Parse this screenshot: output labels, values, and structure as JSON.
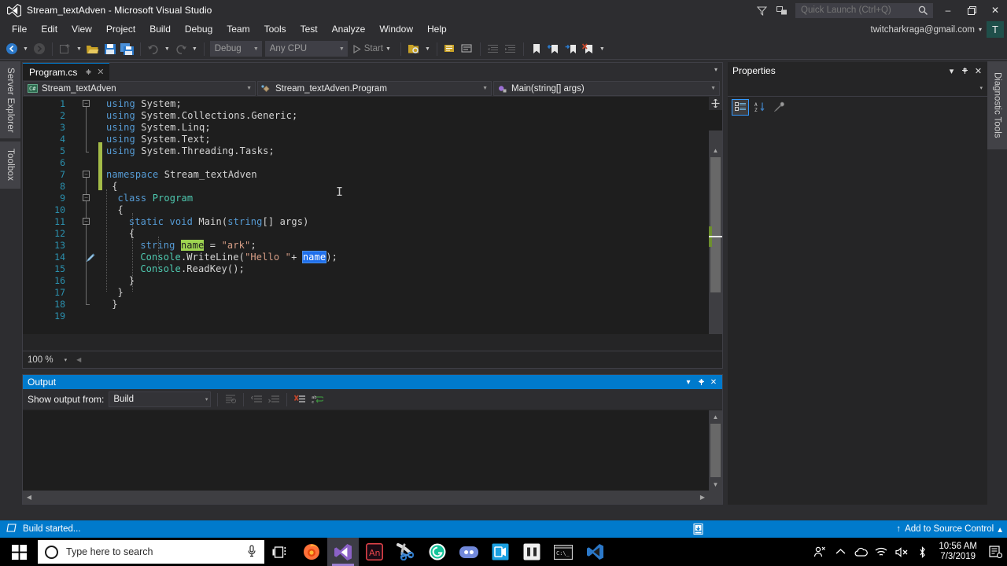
{
  "titlebar": {
    "title": "Stream_textAdven - Microsoft Visual Studio",
    "logo_icon": "visual-studio-logo",
    "feedback_icon": "feedback-funnel-icon",
    "notify_icon": "notifications-icon",
    "search_icon": "search-icon",
    "minimize": "–",
    "maximize": "❐",
    "close": "✕"
  },
  "quick_launch": {
    "placeholder": "Quick Launch (Ctrl+Q)",
    "value": ""
  },
  "menu": {
    "items": [
      "File",
      "Edit",
      "View",
      "Project",
      "Build",
      "Debug",
      "Team",
      "Tools",
      "Test",
      "Analyze",
      "Window",
      "Help"
    ]
  },
  "account": {
    "email": "twitcharkraga@gmail.com",
    "avatar_initial": "T",
    "caret": "▾"
  },
  "toolbar": {
    "back_icon": "navigate-backward-icon",
    "forward_icon": "navigate-forward-icon",
    "new_project_icon": "new-project-icon",
    "open_file_icon": "open-file-icon",
    "save_icon": "save-icon",
    "save_all_icon": "save-all-icon",
    "undo_icon": "undo-icon",
    "redo_icon": "redo-icon",
    "config": "Debug",
    "platform": "Any CPU",
    "start_label": "Start",
    "start_icon": "start-debug-icon",
    "find_icon": "find-in-files-icon",
    "comment_icon": "comment-selection-icon",
    "uncomment_icon": "uncomment-selection-icon",
    "outdent_icon": "outdent-icon",
    "indent_icon": "indent-icon",
    "bookmark_icon": "toggle-bookmark-icon",
    "prev_bookmark_icon": "previous-bookmark-icon",
    "next_bookmark_icon": "next-bookmark-icon",
    "clear_bookmarks_icon": "clear-bookmarks-icon",
    "overflow_icon": "toolbar-overflow-icon"
  },
  "left_rail": {
    "server_explorer": "Server Explorer",
    "toolbox": "Toolbox"
  },
  "right_rail": {
    "diagnostic_tools": "Diagnostic Tools"
  },
  "editor": {
    "tab_label": "Program.cs",
    "pin_icon": "pin-icon",
    "close_icon": "close-icon",
    "tabstrip_caret": "▾",
    "nav_project": "Stream_textAdven",
    "nav_project_icon": "csharp-project-icon",
    "nav_class": "Stream_textAdven.Program",
    "nav_class_icon": "class-icon",
    "nav_member": "Main(string[] args)",
    "nav_member_icon": "method-icon",
    "zoom_level": "100 %",
    "zoom_caret": "▾",
    "split_handle_icon": "split-view-handle-icon",
    "scroll_up_icon": "▲",
    "scroll_down_icon": "▼",
    "line_numbers": [
      1,
      2,
      3,
      4,
      5,
      6,
      7,
      8,
      9,
      10,
      11,
      12,
      13,
      14,
      15,
      16,
      17,
      18,
      19
    ],
    "edit_pencil_icon": "edit-pencil-icon",
    "lines": [
      {
        "n": 1,
        "indent": 0,
        "tokens": [
          {
            "t": "using",
            "c": "k"
          },
          {
            "t": " System;",
            "c": "id"
          }
        ]
      },
      {
        "n": 2,
        "indent": 0,
        "tokens": [
          {
            "t": "using",
            "c": "k"
          },
          {
            "t": " System.Collections.Generic;",
            "c": "id"
          }
        ]
      },
      {
        "n": 3,
        "indent": 0,
        "tokens": [
          {
            "t": "using",
            "c": "k"
          },
          {
            "t": " System.Linq;",
            "c": "id"
          }
        ]
      },
      {
        "n": 4,
        "indent": 0,
        "tokens": [
          {
            "t": "using",
            "c": "k"
          },
          {
            "t": " System.Text;",
            "c": "id"
          }
        ]
      },
      {
        "n": 5,
        "indent": 0,
        "tokens": [
          {
            "t": "using",
            "c": "k"
          },
          {
            "t": " System.Threading.Tasks;",
            "c": "id"
          }
        ]
      },
      {
        "n": 6,
        "indent": 0,
        "tokens": []
      },
      {
        "n": 7,
        "indent": 0,
        "tokens": [
          {
            "t": "namespace",
            "c": "k"
          },
          {
            "t": " Stream_textAdven",
            "c": "id"
          }
        ]
      },
      {
        "n": 8,
        "indent": 1,
        "tokens": [
          {
            "t": "{",
            "c": "id"
          }
        ]
      },
      {
        "n": 9,
        "indent": 2,
        "tokens": [
          {
            "t": "class",
            "c": "k"
          },
          {
            "t": " ",
            "c": "id"
          },
          {
            "t": "Program",
            "c": "cl"
          }
        ]
      },
      {
        "n": 10,
        "indent": 2,
        "tokens": [
          {
            "t": "{",
            "c": "id"
          }
        ]
      },
      {
        "n": 11,
        "indent": 4,
        "tokens": [
          {
            "t": "static",
            "c": "k"
          },
          {
            "t": " ",
            "c": "id"
          },
          {
            "t": "void",
            "c": "k"
          },
          {
            "t": " Main(",
            "c": "id"
          },
          {
            "t": "string",
            "c": "k"
          },
          {
            "t": "[] args)",
            "c": "id"
          }
        ]
      },
      {
        "n": 12,
        "indent": 4,
        "tokens": [
          {
            "t": "{",
            "c": "id"
          }
        ]
      },
      {
        "n": 13,
        "indent": 6,
        "tokens": [
          {
            "t": "string",
            "c": "k"
          },
          {
            "t": " ",
            "c": "id"
          },
          {
            "t": "name",
            "c": "hl-green"
          },
          {
            "t": " = ",
            "c": "id"
          },
          {
            "t": "\"ark\"",
            "c": "st"
          },
          {
            "t": ";",
            "c": "id"
          }
        ]
      },
      {
        "n": 14,
        "indent": 6,
        "tokens": [
          {
            "t": "Console",
            "c": "ty"
          },
          {
            "t": ".WriteLine(",
            "c": "id"
          },
          {
            "t": "\"Hello \"",
            "c": "st"
          },
          {
            "t": "+ ",
            "c": "id"
          },
          {
            "t": "name",
            "c": "hl-blue"
          },
          {
            "t": ");",
            "c": "id"
          }
        ]
      },
      {
        "n": 15,
        "indent": 6,
        "tokens": [
          {
            "t": "Console",
            "c": "ty"
          },
          {
            "t": ".ReadKey();",
            "c": "id"
          }
        ]
      },
      {
        "n": 16,
        "indent": 4,
        "tokens": [
          {
            "t": "}",
            "c": "id"
          }
        ]
      },
      {
        "n": 17,
        "indent": 2,
        "tokens": [
          {
            "t": "}",
            "c": "id"
          }
        ]
      },
      {
        "n": 18,
        "indent": 1,
        "tokens": [
          {
            "t": "}",
            "c": "id"
          }
        ]
      },
      {
        "n": 19,
        "indent": 0,
        "tokens": []
      }
    ]
  },
  "output": {
    "title": "Output",
    "dropdown_icon": "▾",
    "pin_icon": "⟁",
    "close_icon": "✕",
    "show_output_label": "Show output from:",
    "source": "Build",
    "source_caret": "▾",
    "find_message_icon": "find-message-icon",
    "go_to_prev_icon": "go-to-previous-message-icon",
    "go_to_next_icon": "go-to-next-message-icon",
    "clear_all_icon": "clear-all-icon",
    "toggle_wordwrap_icon": "toggle-word-wrap-icon",
    "body_text": ""
  },
  "properties": {
    "title": "Properties",
    "dropdown_icon": "▾",
    "pin_icon": "⟁",
    "close_icon": "✕",
    "object_caret": "▾",
    "categorized_icon": "categorized-view-icon",
    "alphabetical_icon": "alphabetical-sort-icon",
    "property_pages_icon": "property-pages-icon"
  },
  "statusbar": {
    "icon": "build-status-icon",
    "message": "Build started...",
    "upload_icon": "publish-icon",
    "source_control_arrow": "↑",
    "source_control_label": "Add to Source Control",
    "source_control_caret": "▴",
    "accent_color": "#007acc"
  },
  "taskbar": {
    "start_icon": "windows-start-icon",
    "search_placeholder": "Type here to search",
    "mic_icon": "cortana-microphone-icon",
    "taskview_icon": "task-view-icon",
    "apps": [
      {
        "name": "firefox-taskbar-icon",
        "active": false
      },
      {
        "name": "visual-studio-taskbar-icon",
        "active": true
      },
      {
        "name": "adobe-animate-taskbar-icon",
        "active": false
      },
      {
        "name": "snipping-tool-taskbar-icon",
        "active": false
      },
      {
        "name": "grammarly-taskbar-icon",
        "active": false
      },
      {
        "name": "discord-taskbar-icon",
        "active": false
      },
      {
        "name": "obs-studio-taskbar-icon",
        "active": false
      },
      {
        "name": "unity-taskbar-icon",
        "active": false
      },
      {
        "name": "command-prompt-taskbar-icon",
        "active": false
      },
      {
        "name": "vscode-taskbar-icon",
        "active": false
      }
    ],
    "tray": {
      "people_icon": "people-icon",
      "chevron_icon": "show-hidden-icons-icon",
      "onedrive_icon": "onedrive-icon",
      "network_icon": "wifi-icon",
      "volume_icon": "volume-muted-icon",
      "bluetooth_icon": "bluetooth-icon",
      "notifications_icon": "action-center-icon"
    },
    "clock_time": "10:56 AM",
    "clock_date": "7/3/2019"
  }
}
